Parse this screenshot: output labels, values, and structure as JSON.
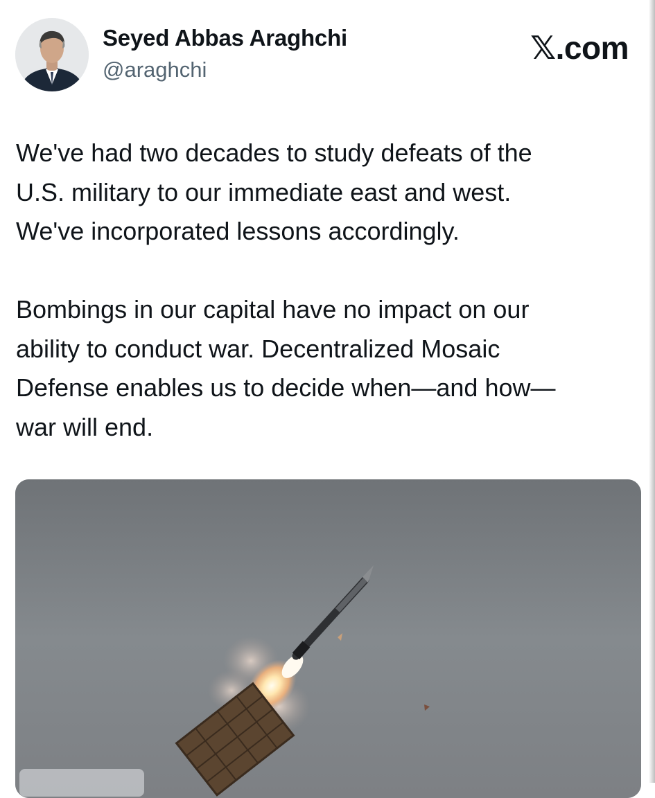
{
  "author": {
    "display_name": "Seyed Abbas Araghchi",
    "handle": "@araghchi",
    "avatar_icon": "profile-photo"
  },
  "brand": {
    "symbol": "𝕏",
    "suffix": ".com"
  },
  "tweet": {
    "paragraph_1": "We've had two decades to study defeats of the\nU.S. military to our immediate east and west.\nWe've incorporated lessons accordingly.",
    "paragraph_2": "Bombings in our capital have no impact on our\nability to conduct war. Decentralized Mosaic\nDefense enables us to decide when—and how—\nwar will end."
  },
  "media": {
    "subject": "missile-launch-photo"
  }
}
